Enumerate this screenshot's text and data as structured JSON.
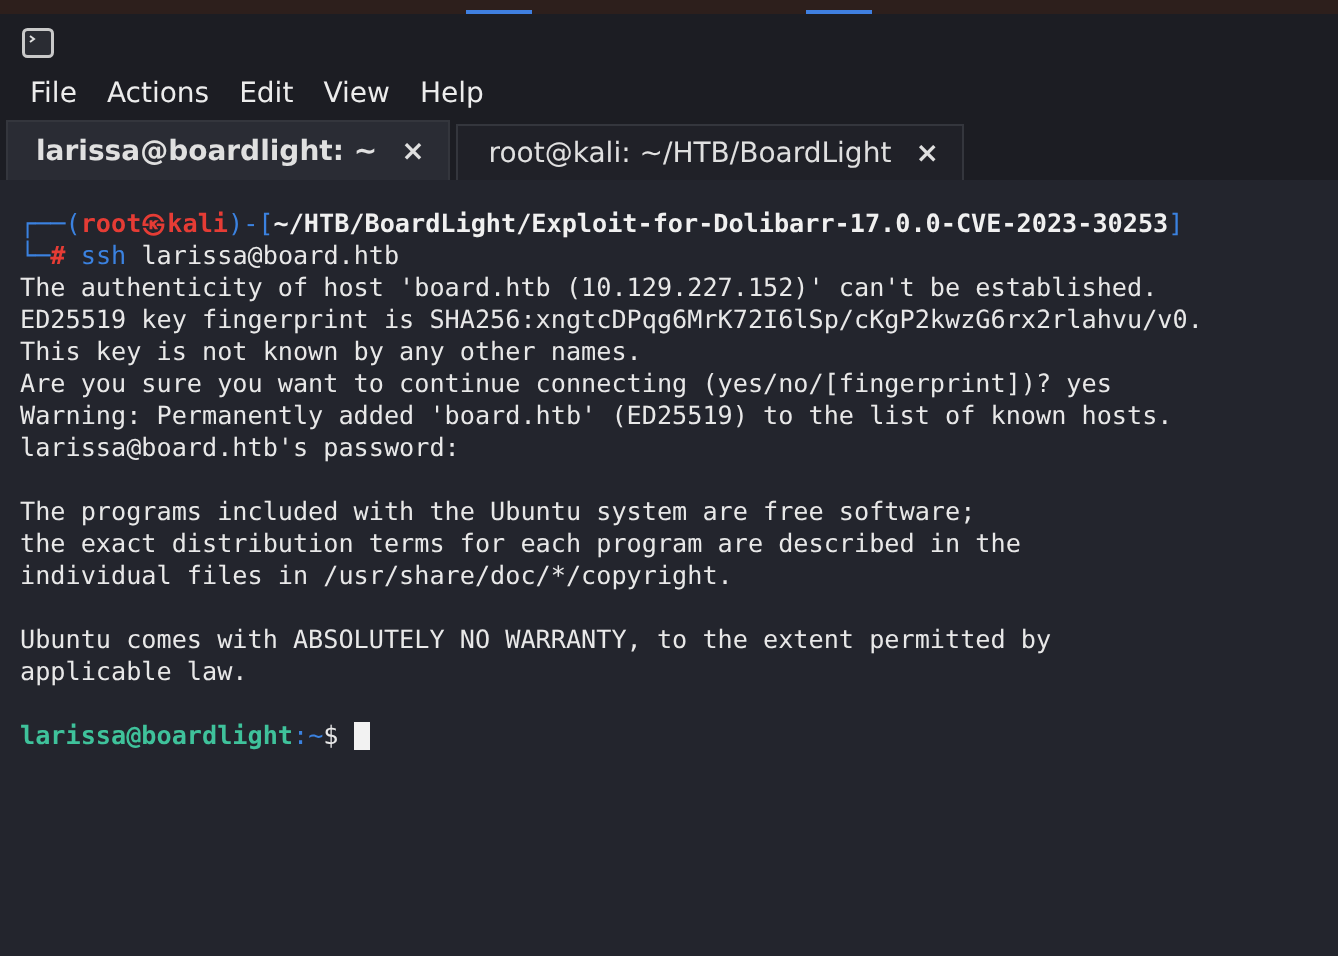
{
  "window": {
    "menu": [
      "File",
      "Actions",
      "Edit",
      "View",
      "Help"
    ]
  },
  "tabs": [
    {
      "label": "larissa@boardlight: ~",
      "close": "×",
      "selected": true
    },
    {
      "label": "root@kali: ~/HTB/BoardLight",
      "close": "×",
      "selected": false
    }
  ],
  "terminal": {
    "lines": [
      {
        "kind": "prompt",
        "segments": [
          {
            "kind": "frame",
            "text": "┌──("
          },
          {
            "kind": "root_user",
            "text": "root㉿kali"
          },
          {
            "kind": "frame",
            "text": ")-["
          },
          {
            "kind": "path",
            "text": "~/HTB/BoardLight/Exploit-for-Dolibarr-17.0.0-CVE-2023-30253"
          },
          {
            "kind": "frame",
            "text": "]"
          }
        ]
      },
      {
        "kind": "prompt",
        "segments": [
          {
            "kind": "frame",
            "text": "└─"
          },
          {
            "kind": "root_symbol",
            "text": "#"
          },
          {
            "kind": "command",
            "text": "ssh"
          },
          {
            "kind": "plain",
            "text": "larissa@board.htb"
          }
        ]
      },
      {
        "kind": "output",
        "text": "The authenticity of host 'board.htb (10.129.227.152)' can't be established."
      },
      {
        "kind": "output",
        "text": "ED25519 key fingerprint is SHA256:xngtcDPqg6MrK72I6lSp/cKgP2kwzG6rx2rlahvu/v0."
      },
      {
        "kind": "output",
        "text": "This key is not known by any other names."
      },
      {
        "kind": "output",
        "text": "Are you sure you want to continue connecting (yes/no/[fingerprint])? yes"
      },
      {
        "kind": "output",
        "text": "Warning: Permanently added 'board.htb' (ED25519) to the list of known hosts."
      },
      {
        "kind": "output",
        "text": "larissa@board.htb's password:"
      },
      {
        "kind": "blank"
      },
      {
        "kind": "output",
        "text": "The programs included with the Ubuntu system are free software;"
      },
      {
        "kind": "output",
        "text": "the exact distribution terms for each program are described in the"
      },
      {
        "kind": "output",
        "text": "individual files in /usr/share/doc/*/copyright."
      },
      {
        "kind": "blank"
      },
      {
        "kind": "output",
        "text": "Ubuntu comes with ABSOLUTELY NO WARRANTY, to the extent permitted by"
      },
      {
        "kind": "output",
        "text": "applicable law."
      },
      {
        "kind": "blank"
      },
      {
        "kind": "prompt",
        "cursor": true,
        "segments": [
          {
            "kind": "user_host",
            "text": "larissa@boardlight"
          },
          {
            "kind": "frame",
            "text": ":~"
          },
          {
            "kind": "plain",
            "text": "$"
          }
        ]
      }
    ]
  }
}
